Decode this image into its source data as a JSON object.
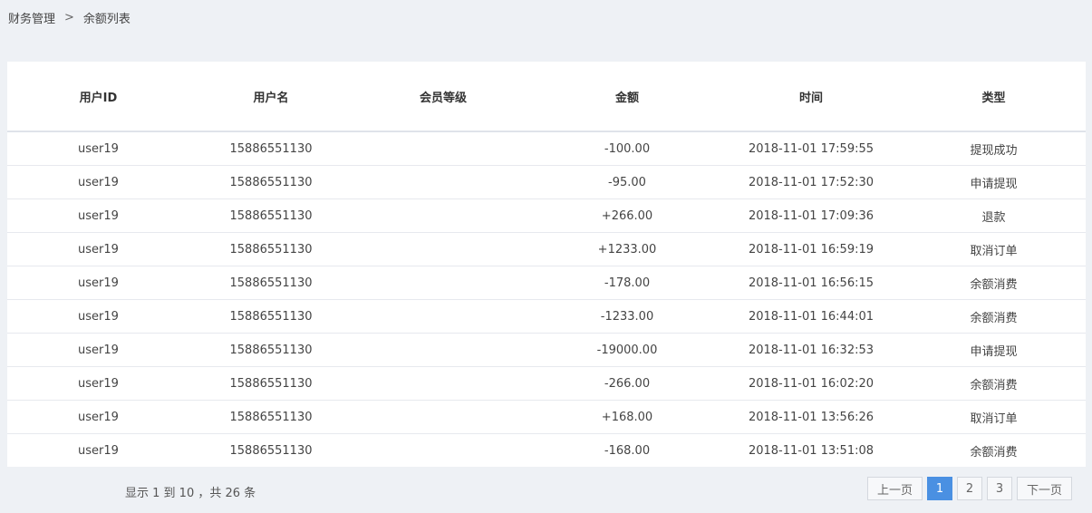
{
  "breadcrumb": {
    "parent": "财务管理",
    "separator": ">",
    "current": "余额列表"
  },
  "table": {
    "headers": [
      "用户ID",
      "用户名",
      "会员等级",
      "金额",
      "时间",
      "类型"
    ],
    "rows": [
      [
        "user19",
        "15886551130",
        "",
        "-100.00",
        "2018-11-01 17:59:55",
        "提现成功"
      ],
      [
        "user19",
        "15886551130",
        "",
        "-95.00",
        "2018-11-01 17:52:30",
        "申请提现"
      ],
      [
        "user19",
        "15886551130",
        "",
        "+266.00",
        "2018-11-01 17:09:36",
        "退款"
      ],
      [
        "user19",
        "15886551130",
        "",
        "+1233.00",
        "2018-11-01 16:59:19",
        "取消订单"
      ],
      [
        "user19",
        "15886551130",
        "",
        "-178.00",
        "2018-11-01 16:56:15",
        "余额消费"
      ],
      [
        "user19",
        "15886551130",
        "",
        "-1233.00",
        "2018-11-01 16:44:01",
        "余额消费"
      ],
      [
        "user19",
        "15886551130",
        "",
        "-19000.00",
        "2018-11-01 16:32:53",
        "申请提现"
      ],
      [
        "user19",
        "15886551130",
        "",
        "-266.00",
        "2018-11-01 16:02:20",
        "余额消费"
      ],
      [
        "user19",
        "15886551130",
        "",
        "+168.00",
        "2018-11-01 13:56:26",
        "取消订单"
      ],
      [
        "user19",
        "15886551130",
        "",
        "-168.00",
        "2018-11-01 13:51:08",
        "余额消费"
      ]
    ]
  },
  "footer": {
    "summary": "显示 1 到 10 ，共 26 条"
  },
  "pagination": {
    "prev": "上一页",
    "pages": [
      "1",
      "2",
      "3"
    ],
    "active": "1",
    "next": "下一页"
  },
  "colors": {
    "background": "#eef1f5",
    "panel": "#ffffff",
    "accent": "#4a90e2"
  }
}
